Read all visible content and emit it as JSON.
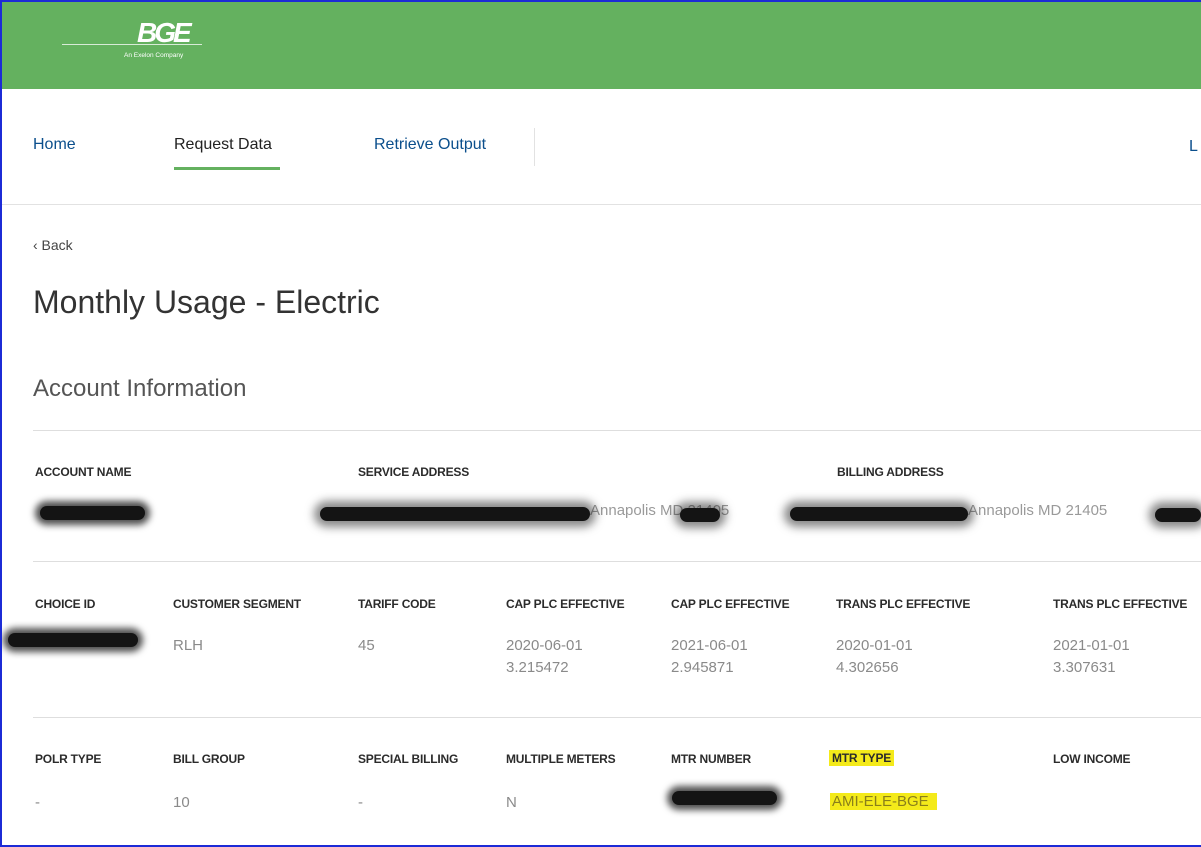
{
  "header": {
    "logo_text": "BGE",
    "logo_tagline": "An Exelon Company",
    "brand_color": "#64b15f"
  },
  "nav": {
    "home": "Home",
    "request_data": "Request Data",
    "retrieve_output": "Retrieve Output",
    "login_partial": "L",
    "active": "Request Data"
  },
  "back_label": "‹ Back",
  "page_title": "Monthly Usage - Electric",
  "section_title": "Account Information",
  "row1": {
    "account_name_label": "ACCOUNT NAME",
    "service_address_label": "SERVICE ADDRESS",
    "billing_address_label": "BILLING ADDRESS",
    "service_address_fragment": "Annapolis MD 21405",
    "billing_address_fragment": "Annapolis MD 21405"
  },
  "row2": {
    "labels": [
      "CHOICE ID",
      "CUSTOMER SEGMENT",
      "TARIFF CODE",
      "CAP PLC EFFECTIVE",
      "CAP PLC EFFECTIVE",
      "TRANS PLC EFFECTIVE",
      "TRANS PLC EFFECTIVE"
    ],
    "customer_segment": "RLH",
    "tariff_code": "45",
    "cap_plc_1_date": "2020-06-01",
    "cap_plc_1_value": "3.215472",
    "cap_plc_2_date": "2021-06-01",
    "cap_plc_2_value": "2.945871",
    "trans_plc_1_date": "2020-01-01",
    "trans_plc_1_value": "4.302656",
    "trans_plc_2_date": "2021-01-01",
    "trans_plc_2_value": "3.307631"
  },
  "row3": {
    "labels": [
      "POLR TYPE",
      "BILL GROUP",
      "SPECIAL BILLING",
      "MULTIPLE METERS",
      "MTR NUMBER",
      "MTR TYPE",
      "LOW INCOME"
    ],
    "polr_type": "-",
    "bill_group": "10",
    "special_billing": "-",
    "multiple_meters": "N",
    "mtr_type": "AMI-ELE-BGE"
  },
  "highlight_color": "#f4ea1a"
}
